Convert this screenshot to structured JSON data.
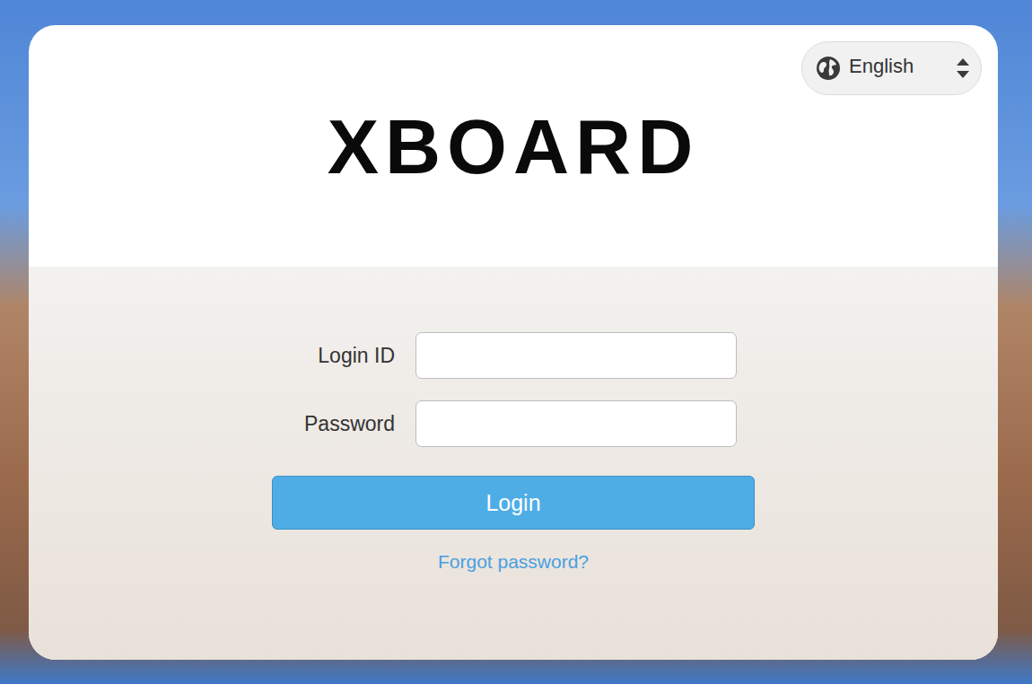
{
  "language": {
    "label": "English"
  },
  "logo": {
    "text": "XBOARD"
  },
  "form": {
    "fields": [
      {
        "label": "Login ID",
        "value": "",
        "kind": "text"
      },
      {
        "label": "Password",
        "value": "",
        "kind": "password"
      }
    ],
    "submit": "Login",
    "forgot": "Forgot password?"
  }
}
